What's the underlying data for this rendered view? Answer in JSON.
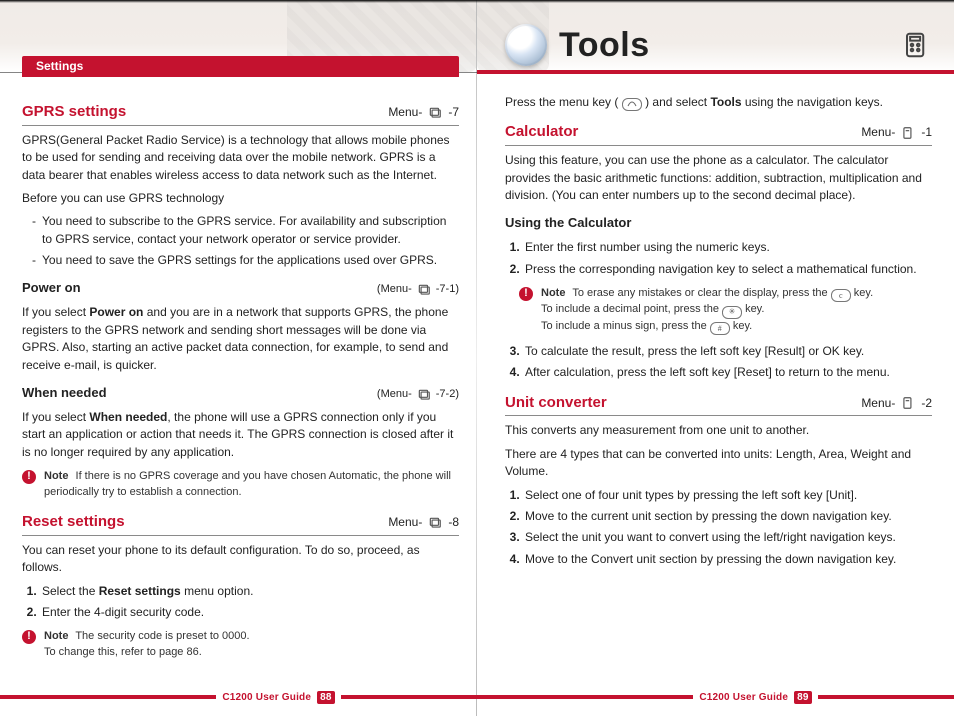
{
  "colors": {
    "accent": "#c4122f"
  },
  "left": {
    "tab": "Settings",
    "footer": {
      "label": "C1200 User Guide",
      "page": "88"
    },
    "s1": {
      "title": "GPRS settings",
      "meta": "Menu-",
      "meta_suffix": "-7",
      "p1": "GPRS(General Packet Radio Service) is a technology that allows mobile phones to be used for sending and receiving data over the mobile network. GPRS is a data bearer that enables wireless access to data network such as the Internet.",
      "p2": "Before you can use GPRS technology",
      "li1": "You need to subscribe to the GPRS service. For availability and subscription to GPRS service, contact your network operator or service provider.",
      "li2": "You need to save the GPRS settings for the applications used over GPRS."
    },
    "sub1": {
      "title": "Power on",
      "meta_prefix": "(Menu-",
      "meta_suffix": "-7-1)",
      "p_pre": "If you select ",
      "bold": "Power on",
      "p_post": " and you are in a network that supports GPRS, the phone registers to the GPRS network and sending short messages will be done via GPRS. Also, starting an active packet data connection, for example, to send and receive e-mail, is quicker."
    },
    "sub2": {
      "title": "When needed",
      "meta_prefix": "(Menu-",
      "meta_suffix": "-7-2)",
      "p_pre": "If you select ",
      "bold": "When needed",
      "p_post": ", the phone will use a GPRS connection only if you start an application or action that needs it. The GPRS connection is closed after it is no longer required by any application.",
      "note": "If there is no GPRS coverage and you have chosen Automatic, the phone will periodically try to establish a connection."
    },
    "s2": {
      "title": "Reset settings",
      "meta": "Menu-",
      "meta_suffix": "-8",
      "p1": "You can reset your phone to its default configuration. To do so, proceed, as follows.",
      "ol1_pre": "Select the ",
      "ol1_bold": "Reset settings",
      "ol1_post": " menu option.",
      "ol2": "Enter the 4-digit security code.",
      "note_l1": "The security code is preset to 0000.",
      "note_l2": "To change this, refer to page 86."
    }
  },
  "right": {
    "bigtitle": "Tools",
    "footer": {
      "label": "C1200 User Guide",
      "page": "89"
    },
    "intro_pre": "Press the menu key ( ",
    "intro_mid": " ) and select ",
    "intro_bold": "Tools",
    "intro_post": " using the navigation keys.",
    "calc": {
      "title": "Calculator",
      "meta": "Menu-",
      "meta_suffix": "-1",
      "p1": "Using this feature, you can use the phone as a calculator. The calculator provides the basic arithmetic functions: addition, subtraction, multiplication and division. (You can enter numbers up to the second decimal place).",
      "using_h": "Using the Calculator",
      "ol1": "Enter the first number using the numeric keys.",
      "ol2": "Press the corresponding navigation key to select a mathematical function.",
      "note_l1_pre": "To erase any mistakes or clear the display, press the ",
      "note_l1_post": " key.",
      "note_l2_pre": "To include a decimal point, press the ",
      "note_l2_post": " key.",
      "note_l3_pre": "To include a minus sign, press the ",
      "note_l3_post": " key.",
      "ol3": "To calculate the result, press the left soft key [Result] or OK key.",
      "ol4": "After calculation, press the left soft key [Reset] to return to the menu."
    },
    "unit": {
      "title": "Unit converter",
      "meta": "Menu-",
      "meta_suffix": "-2",
      "p1": "This converts any measurement from one unit to another.",
      "p2": "There are 4 types that can be converted into units: Length, Area, Weight and Volume.",
      "ol1": "Select one of four unit types by pressing the left soft key [Unit].",
      "ol2": "Move to the current unit section by pressing the down navigation key.",
      "ol3": "Select the unit you want to convert using the left/right navigation keys.",
      "ol4": "Move to the Convert unit section by pressing the down navigation key."
    }
  },
  "labels": {
    "note": "Note"
  }
}
